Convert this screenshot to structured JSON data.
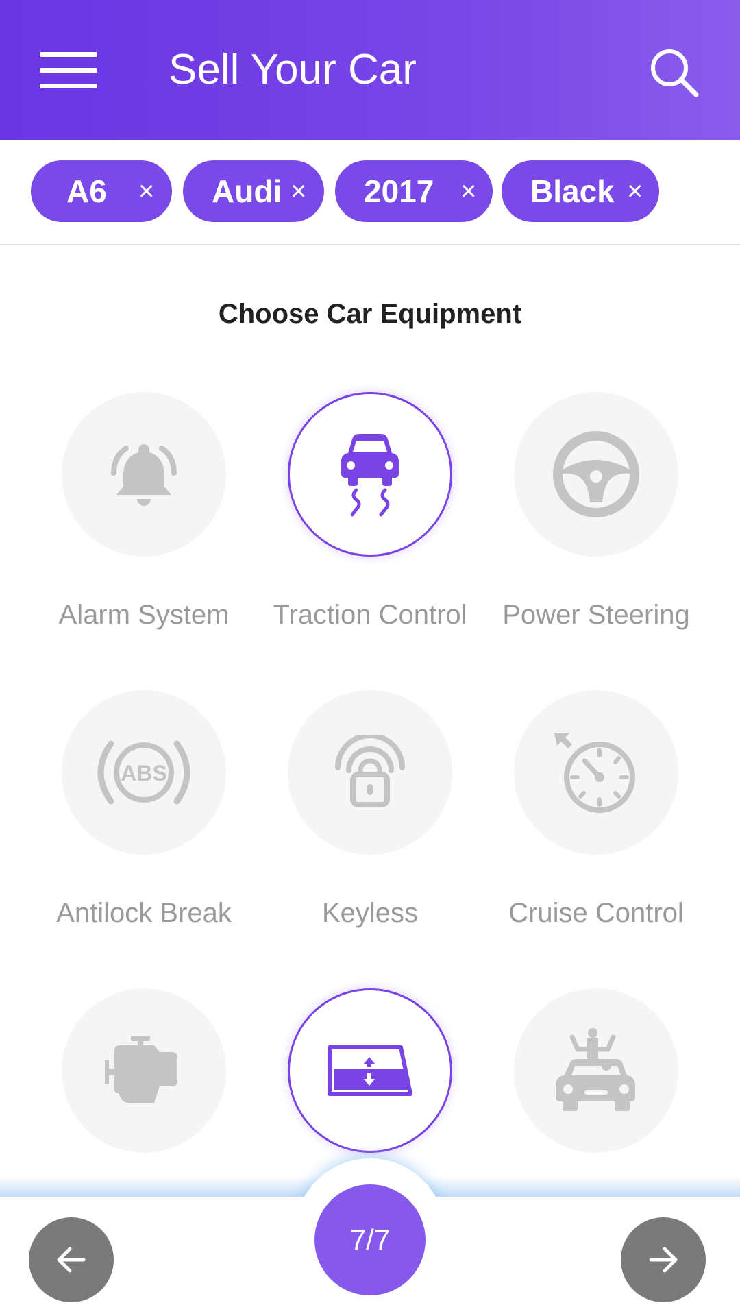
{
  "app_bar": {
    "title": "Sell Your Car",
    "menu_icon": "menu-icon",
    "search_icon": "search-icon",
    "background": "#6a35e3"
  },
  "filters": [
    {
      "label": "A6",
      "remove": "×"
    },
    {
      "label": "Audi",
      "remove": "×"
    },
    {
      "label": "2017",
      "remove": "×"
    },
    {
      "label": "Black",
      "remove": "×"
    }
  ],
  "section_title": "Choose Car Equipment",
  "equipment": [
    {
      "label": "Alarm System",
      "icon": "alarm-bell-icon",
      "selected": false
    },
    {
      "label": "Traction Control",
      "icon": "traction-control-icon",
      "selected": true
    },
    {
      "label": "Power Steering",
      "icon": "steering-wheel-icon",
      "selected": false
    },
    {
      "label": "Antilock Break",
      "icon": "abs-icon",
      "selected": false
    },
    {
      "label": "Keyless",
      "icon": "keyless-lock-icon",
      "selected": false
    },
    {
      "label": "Cruise Control",
      "icon": "speedometer-icon",
      "selected": false
    },
    {
      "label": "",
      "icon": "engine-icon",
      "selected": false
    },
    {
      "label": "",
      "icon": "power-window-icon",
      "selected": true
    },
    {
      "label": "",
      "icon": "convertible-car-icon",
      "selected": false
    }
  ],
  "pager": {
    "label": "7/7"
  },
  "nav": {
    "prev_icon": "arrow-left-icon",
    "next_icon": "arrow-right-icon"
  },
  "colors": {
    "accent": "#7a4ae8",
    "inactive_icon": "#c4c4c4",
    "label_gray": "#9a9a9a",
    "nav_button": "#7a7a7a"
  }
}
